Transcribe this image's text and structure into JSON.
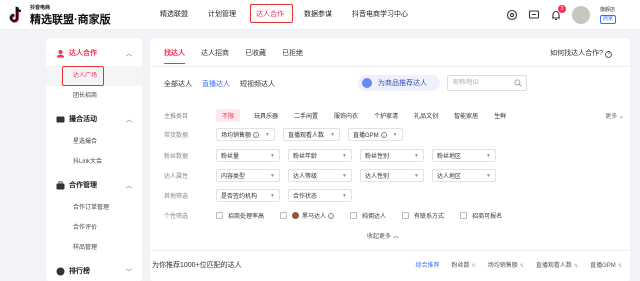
{
  "header": {
    "logo_small": "抖音电商",
    "logo_main": "精选联盟·商家版",
    "nav": [
      "精选联盟",
      "计划管理",
      "达人合作",
      "数据参谋",
      "抖音电商学习中心"
    ],
    "active_nav": "达人合作",
    "notification_count": "3",
    "user_name": "旗舰店",
    "shop_tag": "商家"
  },
  "sidebar": {
    "groups": [
      {
        "title": "达人合作",
        "items": [
          "达人广场",
          "团长招商"
        ]
      },
      {
        "title": "撮合活动",
        "items": [
          "星选撮合",
          "抖Link大会"
        ]
      },
      {
        "title": "合作管理",
        "items": [
          "合作订单管理",
          "合作评价",
          "样品管理"
        ]
      },
      {
        "title": "排行榜",
        "items": []
      }
    ],
    "active_item": "达人广场"
  },
  "main": {
    "tabs": [
      "找达人",
      "达人招商",
      "已收藏",
      "已拒绝"
    ],
    "help": "如何找达人合作?",
    "subtabs": [
      "全部达人",
      "直播达人",
      "短视频达人"
    ],
    "recommend_btn": "为商品推荐达人",
    "search_placeholder": "昵称/短ID",
    "filters": {
      "category": {
        "label": "主推类目",
        "options": [
          "不限",
          "玩具乐器",
          "二手闲置",
          "服饰内衣",
          "个护家清",
          "礼品文创",
          "智能家居",
          "生鲜"
        ],
        "more": "更多"
      },
      "sales": {
        "label": "带货数据",
        "selects": [
          "场均销售额",
          "直播观看人数",
          "直播GPM"
        ]
      },
      "fans": {
        "label": "粉丝数据",
        "selects": [
          "粉丝量",
          "粉丝年龄",
          "粉丝性别",
          "粉丝地区"
        ]
      },
      "attrs": {
        "label": "达人属性",
        "selects": [
          "内容类型",
          "达人等级",
          "达人性别",
          "达人地区"
        ]
      },
      "other": {
        "label": "其他筛选",
        "selects": [
          "是否签约机构",
          "合作状态"
        ]
      },
      "personal": {
        "label": "个性筛选",
        "checks": [
          "招商处理率高",
          "黑马达人",
          "纯佣达人",
          "有联系方式",
          "招商可报名"
        ]
      }
    },
    "collapse": "收起更多",
    "rec_count": "为你推荐1000+位匹配的达人",
    "sorts": [
      "综合推荐",
      "粉丝数",
      "场均销售额",
      "直播观看人数",
      "直播GPM"
    ]
  }
}
